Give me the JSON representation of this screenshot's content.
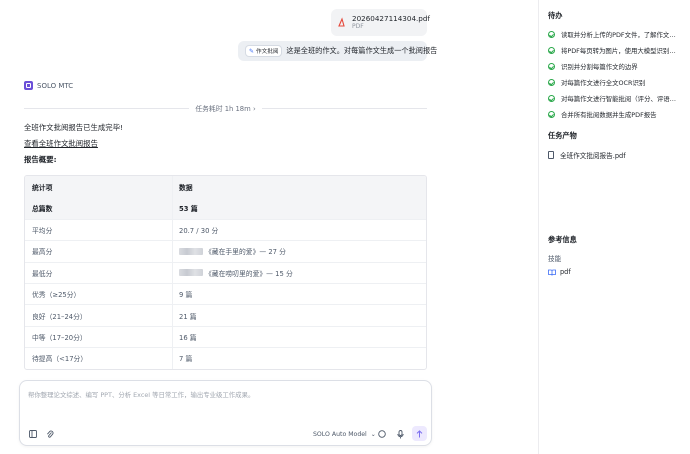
{
  "file_card": {
    "name": "20260427114304.pdf",
    "type": "PDF"
  },
  "user_message": {
    "chip_label": "作文批阅",
    "text": "这是全班的作文。对每篇作文生成一个批阅报告"
  },
  "agent": {
    "name": "SOLO MTC"
  },
  "duration": "任务耗时 1h 18m",
  "duration_chevron": "›",
  "response": {
    "line1": "全班作文批阅报告已生成完毕!",
    "link": "查看全班作文批阅报告",
    "summary_label": "报告概要:"
  },
  "table": {
    "headers": [
      "统计项",
      "数据"
    ],
    "rows": [
      {
        "item": "总篇数",
        "value": "53 篇",
        "redacted": false
      },
      {
        "item": "平均分",
        "value": "20.7 / 30 分",
        "redacted": false
      },
      {
        "item": "最高分",
        "value": "《藏在手里的爱》— 27 分",
        "redacted": true
      },
      {
        "item": "最低分",
        "value": "《藏在唠叨里的爱》— 15 分",
        "redacted": true
      },
      {
        "item": "优秀（≥25分）",
        "value": "9 篇",
        "redacted": false
      },
      {
        "item": "良好（21–24分）",
        "value": "21 篇",
        "redacted": false
      },
      {
        "item": "中等（17–20分）",
        "value": "16 篇",
        "redacted": false
      },
      {
        "item": "待提高（<17分）",
        "value": "7 篇",
        "redacted": false
      }
    ]
  },
  "composer": {
    "placeholder": "帮你整理论文综述、编写 PPT、分析 Excel 等日常工作，输出专业级工作成果。",
    "model": "SOLO Auto Model",
    "model_chevron": "⌄",
    "send_icon": "arrow-up-icon"
  },
  "right_panel": {
    "todo_title": "待办",
    "todos": [
      "读取并分析上传的PDF文件，了解作文数据",
      "将PDF每页转为图片，使用大模型识别手写内容",
      "识别并分割每篇作文的边界",
      "对每篇作文进行全文OCR识别",
      "对每篇作文进行智能批阅（评分、评语、修改建议）",
      "合并所有批阅数据并生成PDF报告"
    ],
    "artifacts_title": "任务产物",
    "artifact": "全班作文批阅报告.pdf",
    "ref_title": "参考信息",
    "skill_label": "技能",
    "skill": "pdf"
  },
  "colors": {
    "accent": "#6b4fd8",
    "check": "#2aa84a",
    "link_blue": "#3b6cf6"
  }
}
